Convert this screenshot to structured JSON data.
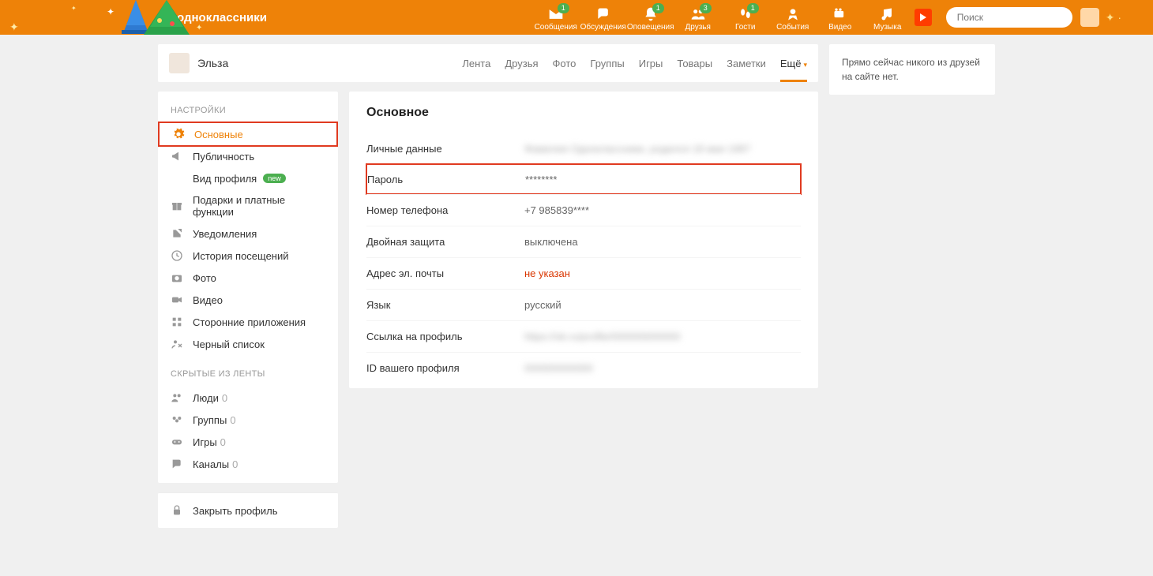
{
  "header": {
    "brand": "одноклассники",
    "nav": [
      {
        "label": "Сообщения",
        "badge": "1"
      },
      {
        "label": "Обсуждения",
        "badge": ""
      },
      {
        "label": "Оповещения",
        "badge": "1"
      },
      {
        "label": "Друзья",
        "badge": "3"
      },
      {
        "label": "Гости",
        "badge": "1"
      },
      {
        "label": "События",
        "badge": ""
      },
      {
        "label": "Видео",
        "badge": ""
      },
      {
        "label": "Музыка",
        "badge": ""
      }
    ],
    "search_placeholder": "Поиск"
  },
  "userbar": {
    "name": "Эльза",
    "tabs": [
      "Лента",
      "Друзья",
      "Фото",
      "Группы",
      "Игры",
      "Товары",
      "Заметки",
      "Ещё"
    ]
  },
  "sidebar": {
    "title_settings": "НАСТРОЙКИ",
    "items": [
      {
        "label": "Основные"
      },
      {
        "label": "Публичность"
      },
      {
        "label": "Вид профиля",
        "new": "new"
      },
      {
        "label": "Подарки и платные функции"
      },
      {
        "label": "Уведомления"
      },
      {
        "label": "История посещений"
      },
      {
        "label": "Фото"
      },
      {
        "label": "Видео"
      },
      {
        "label": "Сторонние приложения"
      },
      {
        "label": "Черный список"
      }
    ],
    "title_hidden": "СКРЫТЫЕ ИЗ ЛЕНТЫ",
    "hidden": [
      {
        "label": "Люди",
        "count": "0"
      },
      {
        "label": "Группы",
        "count": "0"
      },
      {
        "label": "Игры",
        "count": "0"
      },
      {
        "label": "Каналы",
        "count": "0"
      }
    ],
    "close_profile": "Закрыть профиль"
  },
  "panel": {
    "title": "Основное",
    "rows": {
      "personal": {
        "label": "Личные данные",
        "value": "Фамилия Одноклассники, родился 18 мая 1987"
      },
      "password": {
        "label": "Пароль",
        "value": "********"
      },
      "phone": {
        "label": "Номер телефона",
        "value": "+7 985839****"
      },
      "twofa": {
        "label": "Двойная защита",
        "value": "выключена"
      },
      "email": {
        "label": "Адрес эл. почты",
        "value": "не указан"
      },
      "lang": {
        "label": "Язык",
        "value": "русский"
      },
      "profile_url": {
        "label": "Ссылка на профиль",
        "value": "https://ok.ru/profile/000000000000"
      },
      "profile_id": {
        "label": "ID вашего профиля",
        "value": "000000000000"
      }
    }
  },
  "right": {
    "text": "Прямо сейчас никого из друзей на сайте нет."
  }
}
